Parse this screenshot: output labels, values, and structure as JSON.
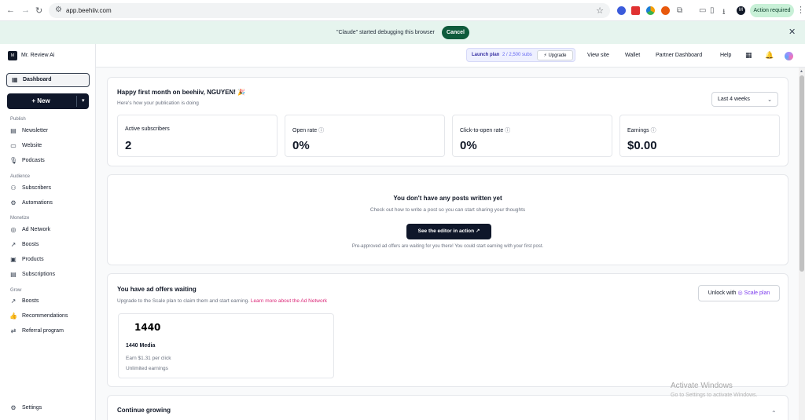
{
  "browser": {
    "back": "←",
    "forward": "→",
    "reload": "↻",
    "url": "app.beehiiv.com",
    "action_required": "Action required",
    "profile_initials": "M"
  },
  "debug_bar": {
    "message": "\"Claude\" started debugging this browser",
    "cancel": "Cancel"
  },
  "sidebar": {
    "brand": "Mr. Review Ai",
    "brand_logo": "M",
    "dashboard": "Dashboard",
    "new_button": "New",
    "sections": {
      "publish": "Publish",
      "audience": "Audience",
      "monetize": "Monetize",
      "grow": "Grow"
    },
    "items": {
      "newsletter": "Newsletter",
      "website": "Website",
      "podcasts": "Podcasts",
      "subscribers": "Subscribers",
      "automations": "Automations",
      "ad_network": "Ad Network",
      "boosts_monetize": "Boosts",
      "products": "Products",
      "subscriptions": "Subscriptions",
      "boosts_grow": "Boosts",
      "recommendations": "Recommendations",
      "referral_program": "Referral program",
      "settings": "Settings"
    }
  },
  "topbar": {
    "plan_name": "Launch plan",
    "plan_usage": "2 / 2,500 subs",
    "upgrade": "Upgrade",
    "view_site": "View site",
    "wallet": "Wallet",
    "partner_dashboard": "Partner Dashboard",
    "help": "Help"
  },
  "overview": {
    "greeting": "Happy first month on beehiiv, NGUYEN! 🎉",
    "subtitle": "Here's how your publication is doing",
    "range": "Last 4 weeks",
    "stats": [
      {
        "label": "Active subscribers",
        "value": "2"
      },
      {
        "label": "Open rate",
        "value": "0%"
      },
      {
        "label": "Click-to-open rate",
        "value": "0%"
      },
      {
        "label": "Earnings",
        "value": "$0.00"
      }
    ]
  },
  "posts": {
    "title": "You don't have any posts written yet",
    "subtitle": "Check out how to write a post so you can start sharing your thoughts",
    "button": "See the editor in action",
    "note": "Pre-approved ad offers are waiting for you there! You could start earning with your first post."
  },
  "ads": {
    "title": "You have ad offers waiting",
    "subtitle": "Upgrade to the Scale plan to claim them and start earning.",
    "link": "Learn more about the Ad Network",
    "unlock_prefix": "Unlock with",
    "unlock_plan": "Scale plan",
    "offer": {
      "logo_text": "1440",
      "name": "1440 Media",
      "rate": "Earn $1.31 per click",
      "limit": "Unlimited earnings"
    }
  },
  "growing": {
    "title": "Continue growing"
  },
  "watermark": {
    "line1": "Activate Windows",
    "line2": "Go to Settings to activate Windows."
  }
}
